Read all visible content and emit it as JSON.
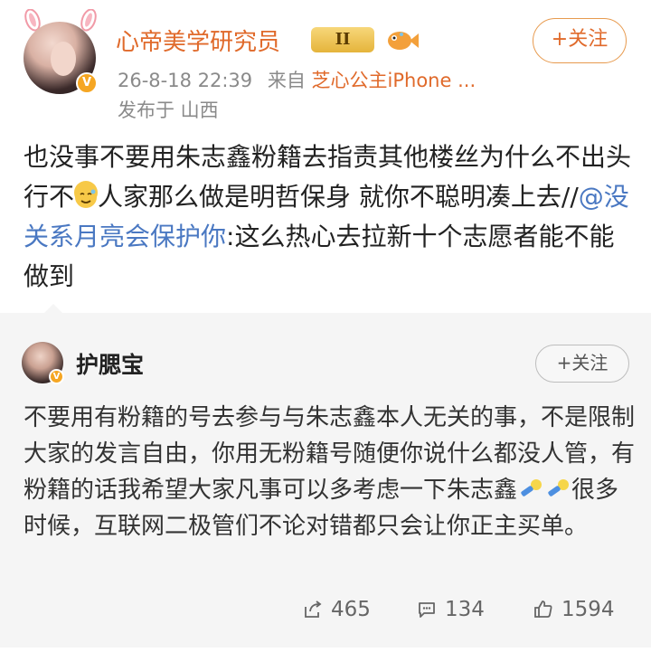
{
  "post": {
    "username": "心帝美学研究员",
    "level_badge": "II",
    "timestamp": "26-8-18 22:39",
    "source_prefix": "来自",
    "source": "芝心公主iPhone ...",
    "location": "发布于 山西",
    "follow_label": "+关注",
    "text_part1": "也没事不要用朱志鑫粉籍去指责其他楼丝为什么不出头行不",
    "text_part2": "人家那么做是明哲保身 就你不聪明凑上去//",
    "mention": "@没关系月亮会保护你",
    "text_part3": ":这么热心去拉新十个志愿者能不能做到"
  },
  "repost": {
    "username": "护腮宝",
    "follow_label": "+关注",
    "text_part1": "不要用有粉籍的号去参与与朱志鑫本人无关的事，不是限制大家的发言自由，你用无粉籍号随便你说什么都没人管，有粉籍的话我希望大家凡事可以多考虑一下朱志鑫",
    "text_part2": "很多时候，互联网二极管们不论对错都只会让你正主买单。",
    "actions": {
      "repost_count": "465",
      "comment_count": "134",
      "like_count": "1594"
    }
  },
  "icons": {
    "verified": "verified-v-icon",
    "repost": "share-icon",
    "comment": "comment-icon",
    "like": "thumbs-up-icon"
  },
  "colors": {
    "accent_orange": "#e06a2b",
    "mention_blue": "#4a78c2",
    "meta_gray": "#8a8a8a",
    "repost_bg": "#f5f5f5"
  }
}
